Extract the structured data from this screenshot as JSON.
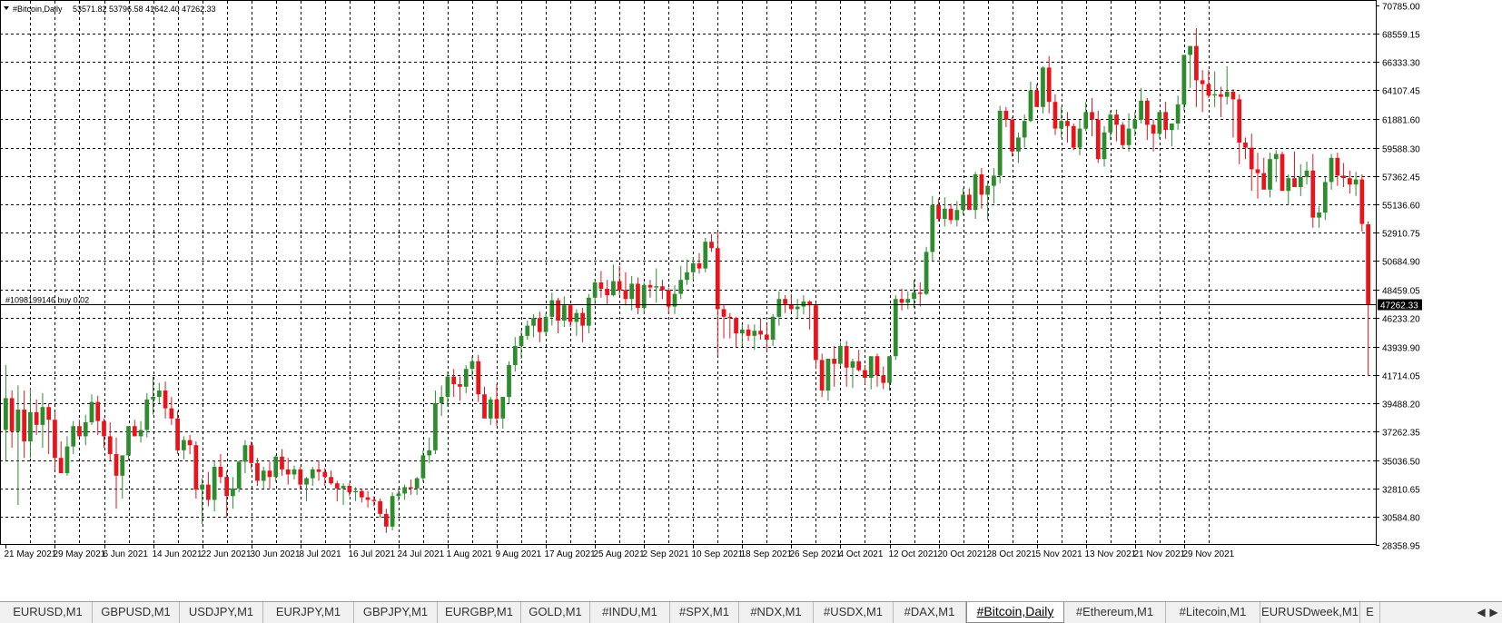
{
  "chart_data": {
    "type": "candlestick",
    "title": "#Bitcoin,Daily",
    "header_values": "53571.82 53796.58 41642.40 47262.33",
    "ylim": [
      28358.95,
      70785.0
    ],
    "y_ticks": [
      "70785.00",
      "68559.15",
      "66333.30",
      "64107.45",
      "61881.60",
      "59588.30",
      "57362.45",
      "55136.60",
      "52910.75",
      "50684.90",
      "48459.05",
      "46233.20",
      "43939.90",
      "41714.05",
      "39488.20",
      "37262.35",
      "35036.50",
      "32810.65",
      "30584.80",
      "28358.95"
    ],
    "x_labels": [
      "21 May 2021",
      "29 May 2021",
      "6 Jun 2021",
      "14 Jun 2021",
      "22 Jun 2021",
      "30 Jun 2021",
      "8 Jul 2021",
      "16 Jul 2021",
      "24 Jul 2021",
      "1 Aug 2021",
      "9 Aug 2021",
      "17 Aug 2021",
      "25 Aug 2021",
      "2 Sep 2021",
      "10 Sep 2021",
      "18 Sep 2021",
      "26 Sep 2021",
      "4 Oct 2021",
      "12 Oct 2021",
      "20 Oct 2021",
      "28 Oct 2021",
      "5 Nov 2021",
      "13 Nov 2021",
      "21 Nov 2021",
      "29 Nov 2021"
    ],
    "order_line": {
      "label": "#1098199146 buy 0.02",
      "price": 47262.33,
      "price_label": "47262.33"
    },
    "candles": [
      [
        37400,
        42500,
        35000,
        39900
      ],
      [
        39900,
        40500,
        36000,
        37300
      ],
      [
        37300,
        40900,
        31500,
        39000
      ],
      [
        39000,
        40500,
        35200,
        36500
      ],
      [
        36500,
        40700,
        35200,
        38800
      ],
      [
        38800,
        39800,
        37000,
        37800
      ],
      [
        37800,
        40300,
        36000,
        39200
      ],
      [
        39200,
        39500,
        35500,
        38200
      ],
      [
        38200,
        38800,
        34300,
        35200
      ],
      [
        35200,
        36500,
        34000,
        34000
      ],
      [
        34000,
        36900,
        33800,
        36100
      ],
      [
        36100,
        38100,
        35500,
        37700
      ],
      [
        37700,
        38200,
        36800,
        36900
      ],
      [
        36900,
        38600,
        36200,
        38000
      ],
      [
        38000,
        40200,
        37800,
        39600
      ],
      [
        39600,
        40100,
        37000,
        38100
      ],
      [
        38100,
        38300,
        36000,
        36900
      ],
      [
        36900,
        38000,
        35000,
        35500
      ],
      [
        35500,
        36800,
        31200,
        33800
      ],
      [
        33800,
        35000,
        32000,
        35400
      ],
      [
        35400,
        37500,
        35000,
        37700
      ],
      [
        37700,
        38200,
        36900,
        36900
      ],
      [
        36900,
        38100,
        36400,
        37400
      ],
      [
        37400,
        40300,
        36800,
        39800
      ],
      [
        39800,
        41600,
        38600,
        40000
      ],
      [
        40000,
        41100,
        39500,
        40500
      ],
      [
        40500,
        41200,
        38300,
        39100
      ],
      [
        39100,
        40000,
        37800,
        38300
      ],
      [
        38300,
        38900,
        35500,
        35800
      ],
      [
        35800,
        36900,
        35100,
        36600
      ],
      [
        36600,
        37000,
        35500,
        36200
      ],
      [
        36200,
        36500,
        32000,
        32700
      ],
      [
        32700,
        33600,
        30000,
        33100
      ],
      [
        33100,
        34100,
        31400,
        31900
      ],
      [
        31900,
        35000,
        31000,
        34500
      ],
      [
        34500,
        35500,
        33200,
        33700
      ],
      [
        33700,
        34200,
        30500,
        32200
      ],
      [
        32200,
        33700,
        31200,
        32800
      ],
      [
        32800,
        35000,
        32500,
        34900
      ],
      [
        34900,
        36600,
        34000,
        36200
      ],
      [
        36200,
        36500,
        34300,
        34800
      ],
      [
        34800,
        35200,
        33000,
        33400
      ],
      [
        33400,
        34500,
        32800,
        34200
      ],
      [
        34200,
        34900,
        32800,
        33700
      ],
      [
        33700,
        35400,
        33300,
        35300
      ],
      [
        35300,
        35900,
        33800,
        34300
      ],
      [
        34300,
        35200,
        33100,
        33900
      ],
      [
        33900,
        34600,
        33500,
        34300
      ],
      [
        34300,
        34500,
        32700,
        33100
      ],
      [
        33100,
        33700,
        31800,
        33600
      ],
      [
        33600,
        34500,
        33000,
        34300
      ],
      [
        34300,
        35000,
        33400,
        34100
      ],
      [
        34100,
        34400,
        33000,
        33700
      ],
      [
        33700,
        34200,
        33100,
        33200
      ],
      [
        33200,
        33400,
        31800,
        32800
      ],
      [
        32800,
        33200,
        31500,
        33000
      ],
      [
        33000,
        33200,
        32200,
        32500
      ],
      [
        32500,
        32900,
        31800,
        32600
      ],
      [
        32600,
        32800,
        31700,
        32100
      ],
      [
        32100,
        32600,
        31300,
        31900
      ],
      [
        31900,
        32200,
        31400,
        31800
      ],
      [
        31800,
        32000,
        30500,
        30800
      ],
      [
        30800,
        31200,
        29300,
        29800
      ],
      [
        29800,
        32500,
        29500,
        32200
      ],
      [
        32200,
        32800,
        31800,
        32400
      ],
      [
        32400,
        33100,
        31900,
        32900
      ],
      [
        32900,
        33500,
        32300,
        32800
      ],
      [
        32800,
        33700,
        32300,
        33600
      ],
      [
        33600,
        35800,
        33300,
        35400
      ],
      [
        35400,
        36800,
        34800,
        35800
      ],
      [
        35800,
        40500,
        35500,
        39500
      ],
      [
        39500,
        40900,
        38500,
        40000
      ],
      [
        40000,
        42000,
        39200,
        41600
      ],
      [
        41600,
        42200,
        40000,
        41000
      ],
      [
        41000,
        41600,
        39700,
        40800
      ],
      [
        40800,
        42500,
        40300,
        42200
      ],
      [
        42200,
        43200,
        41500,
        42800
      ],
      [
        42800,
        43300,
        39600,
        40200
      ],
      [
        40200,
        40800,
        38500,
        38300
      ],
      [
        38300,
        40000,
        37800,
        39800
      ],
      [
        39800,
        41000,
        37700,
        38300
      ],
      [
        38300,
        40000,
        37500,
        40000
      ],
      [
        40000,
        42800,
        39500,
        42500
      ],
      [
        42500,
        44700,
        42000,
        44000
      ],
      [
        44000,
        45200,
        43000,
        44800
      ],
      [
        44800,
        46000,
        44500,
        45600
      ],
      [
        45600,
        46500,
        44700,
        46200
      ],
      [
        46200,
        46700,
        44300,
        45100
      ],
      [
        45100,
        46600,
        44800,
        46300
      ],
      [
        46300,
        48200,
        45600,
        47600
      ],
      [
        47600,
        47800,
        45000,
        46000
      ],
      [
        46000,
        47900,
        45500,
        47200
      ],
      [
        47200,
        47300,
        45500,
        45900
      ],
      [
        45900,
        46900,
        44800,
        46600
      ],
      [
        46600,
        47000,
        44300,
        45600
      ],
      [
        45600,
        48100,
        45000,
        47800
      ],
      [
        47800,
        49300,
        47200,
        49000
      ],
      [
        49000,
        49900,
        47800,
        48500
      ],
      [
        48500,
        49200,
        47300,
        48000
      ],
      [
        48000,
        50400,
        47900,
        49100
      ],
      [
        49100,
        50300,
        48000,
        48400
      ],
      [
        48400,
        49800,
        47200,
        47700
      ],
      [
        47700,
        49500,
        46800,
        48900
      ],
      [
        48900,
        49400,
        46500,
        47000
      ],
      [
        47000,
        49000,
        46500,
        48800
      ],
      [
        48800,
        49200,
        47800,
        48600
      ],
      [
        48600,
        50100,
        47400,
        48700
      ],
      [
        48700,
        49200,
        47700,
        48400
      ],
      [
        48400,
        48600,
        46500,
        47100
      ],
      [
        47100,
        48800,
        46500,
        48100
      ],
      [
        48100,
        50300,
        47700,
        49200
      ],
      [
        49200,
        50800,
        48800,
        49800
      ],
      [
        49800,
        51000,
        49200,
        50500
      ],
      [
        50500,
        51300,
        49700,
        50100
      ],
      [
        50100,
        52500,
        49800,
        52200
      ],
      [
        52200,
        52800,
        51400,
        51700
      ],
      [
        51700,
        53000,
        43200,
        46900
      ],
      [
        46900,
        47300,
        44600,
        46300
      ],
      [
        46300,
        46600,
        44600,
        46200
      ],
      [
        46200,
        46300,
        43900,
        45000
      ],
      [
        45000,
        45700,
        44000,
        45300
      ],
      [
        45300,
        45700,
        44400,
        44800
      ],
      [
        44800,
        45700,
        43700,
        45200
      ],
      [
        45200,
        46200,
        44500,
        44900
      ],
      [
        44900,
        45700,
        43600,
        44500
      ],
      [
        44500,
        46500,
        44000,
        46300
      ],
      [
        46300,
        48300,
        45600,
        47700
      ],
      [
        47700,
        48000,
        46600,
        47300
      ],
      [
        47300,
        48100,
        46700,
        46900
      ],
      [
        46900,
        47700,
        46200,
        47100
      ],
      [
        47100,
        48000,
        46500,
        47500
      ],
      [
        47500,
        47600,
        45300,
        47200
      ],
      [
        47200,
        47400,
        42200,
        42900
      ],
      [
        42900,
        43400,
        40000,
        40500
      ],
      [
        40500,
        43000,
        39700,
        43000
      ],
      [
        43000,
        44000,
        40800,
        42600
      ],
      [
        42600,
        44300,
        42400,
        44000
      ],
      [
        44000,
        44400,
        40800,
        42300
      ],
      [
        42300,
        43000,
        40700,
        42800
      ],
      [
        42800,
        43700,
        42000,
        42100
      ],
      [
        42100,
        42500,
        41000,
        41500
      ],
      [
        41500,
        42900,
        40600,
        43200
      ],
      [
        43200,
        43400,
        40800,
        41700
      ],
      [
        41700,
        42400,
        40600,
        41100
      ],
      [
        41100,
        43000,
        40500,
        43200
      ],
      [
        43200,
        48000,
        42900,
        47700
      ],
      [
        47700,
        48500,
        46800,
        47400
      ],
      [
        47400,
        48300,
        46900,
        47700
      ],
      [
        47700,
        49200,
        47000,
        48200
      ],
      [
        48200,
        49000,
        47100,
        48100
      ],
      [
        48100,
        51800,
        48000,
        51400
      ],
      [
        51400,
        55800,
        50700,
        55100
      ],
      [
        55100,
        55600,
        53800,
        54000
      ],
      [
        54000,
        55700,
        53400,
        54800
      ],
      [
        54800,
        55200,
        53600,
        53900
      ],
      [
        53900,
        55400,
        53400,
        54700
      ],
      [
        54700,
        56400,
        54300,
        55900
      ],
      [
        55900,
        56400,
        54800,
        54700
      ],
      [
        54700,
        57700,
        54000,
        57500
      ],
      [
        57500,
        58000,
        54800,
        55900
      ],
      [
        55900,
        57000,
        53900,
        56600
      ],
      [
        56600,
        58000,
        55200,
        57400
      ],
      [
        57400,
        62900,
        56800,
        62500
      ],
      [
        62500,
        62800,
        61200,
        61800
      ],
      [
        61800,
        62000,
        58900,
        59300
      ],
      [
        59300,
        60800,
        58400,
        60400
      ],
      [
        60400,
        62200,
        59600,
        61700
      ],
      [
        61700,
        64800,
        61600,
        64100
      ],
      [
        64100,
        64600,
        62900,
        62800
      ],
      [
        62800,
        66000,
        62300,
        65900
      ],
      [
        65900,
        66800,
        62300,
        63200
      ],
      [
        63200,
        63800,
        60600,
        61100
      ],
      [
        61100,
        62800,
        60400,
        61700
      ],
      [
        61700,
        62400,
        60000,
        61300
      ],
      [
        61300,
        61500,
        59400,
        59600
      ],
      [
        59600,
        61800,
        59000,
        61100
      ],
      [
        61100,
        63200,
        60900,
        62400
      ],
      [
        62400,
        63500,
        60500,
        61800
      ],
      [
        61800,
        62500,
        58400,
        58700
      ],
      [
        58700,
        61300,
        58100,
        60800
      ],
      [
        60800,
        62500,
        60200,
        62200
      ],
      [
        62200,
        62600,
        60100,
        61400
      ],
      [
        61400,
        61600,
        59500,
        59800
      ],
      [
        59800,
        62300,
        59300,
        61100
      ],
      [
        61100,
        62400,
        60500,
        61800
      ],
      [
        61800,
        64300,
        61500,
        63300
      ],
      [
        63300,
        63500,
        60200,
        61400
      ],
      [
        61400,
        61800,
        59300,
        60700
      ],
      [
        60700,
        62300,
        60300,
        62400
      ],
      [
        62400,
        63200,
        60300,
        61000
      ],
      [
        61000,
        61400,
        59700,
        61500
      ],
      [
        61500,
        63700,
        61000,
        63000
      ],
      [
        63000,
        66500,
        62500,
        66900
      ],
      [
        66900,
        67300,
        64300,
        67600
      ],
      [
        67600,
        69000,
        62800,
        64900
      ],
      [
        64900,
        65700,
        62400,
        64600
      ],
      [
        64600,
        65700,
        63500,
        63700
      ],
      [
        63700,
        65600,
        62800,
        63800
      ],
      [
        63800,
        64400,
        62000,
        63600
      ],
      [
        63600,
        66000,
        63000,
        64000
      ],
      [
        64000,
        64200,
        60400,
        63400
      ],
      [
        63400,
        63800,
        58300,
        60000
      ],
      [
        60000,
        60400,
        58700,
        59600
      ],
      [
        59600,
        60700,
        56200,
        57900
      ],
      [
        57900,
        59200,
        55600,
        57600
      ],
      [
        57600,
        58800,
        56800,
        56300
      ],
      [
        56300,
        59200,
        55700,
        58700
      ],
      [
        58700,
        59400,
        56900,
        59100
      ],
      [
        59100,
        59300,
        57000,
        56200
      ],
      [
        56200,
        57500,
        55100,
        57200
      ],
      [
        57200,
        59300,
        56600,
        56500
      ],
      [
        56500,
        58300,
        55800,
        57300
      ],
      [
        57300,
        58500,
        56700,
        57800
      ],
      [
        57800,
        59100,
        53300,
        54100
      ],
      [
        54100,
        55000,
        53300,
        54500
      ],
      [
        54500,
        57300,
        53900,
        56900
      ],
      [
        56900,
        59100,
        56300,
        58800
      ],
      [
        58800,
        59200,
        56600,
        57400
      ],
      [
        57400,
        58400,
        56500,
        57200
      ],
      [
        57200,
        57800,
        56000,
        56700
      ],
      [
        56700,
        57700,
        55800,
        57100
      ],
      [
        57100,
        57500,
        53000,
        53600
      ],
      [
        53571.82,
        53796.58,
        41642.4,
        47262.33
      ]
    ]
  },
  "tabs": [
    {
      "label": "EURUSD,M1"
    },
    {
      "label": "GBPUSD,M1"
    },
    {
      "label": "USDJPY,M1"
    },
    {
      "label": "EURJPY,M1"
    },
    {
      "label": "GBPJPY,M1"
    },
    {
      "label": "EURGBP,M1"
    },
    {
      "label": "GOLD,M1"
    },
    {
      "label": "#INDU,M1"
    },
    {
      "label": "#SPX,M1"
    },
    {
      "label": "#NDX,M1"
    },
    {
      "label": "#USDX,M1"
    },
    {
      "label": "#DAX,M1"
    },
    {
      "label": "#Bitcoin,Daily",
      "active": true
    },
    {
      "label": "#Ethereum,M1"
    },
    {
      "label": "#Litecoin,M1"
    },
    {
      "label": "EURUSDweek,M1"
    },
    {
      "label": "E"
    }
  ],
  "colors": {
    "bull": "#2e8b2e",
    "bear": "#e8141c",
    "grid": "#000000",
    "axis_text": "#000000"
  }
}
